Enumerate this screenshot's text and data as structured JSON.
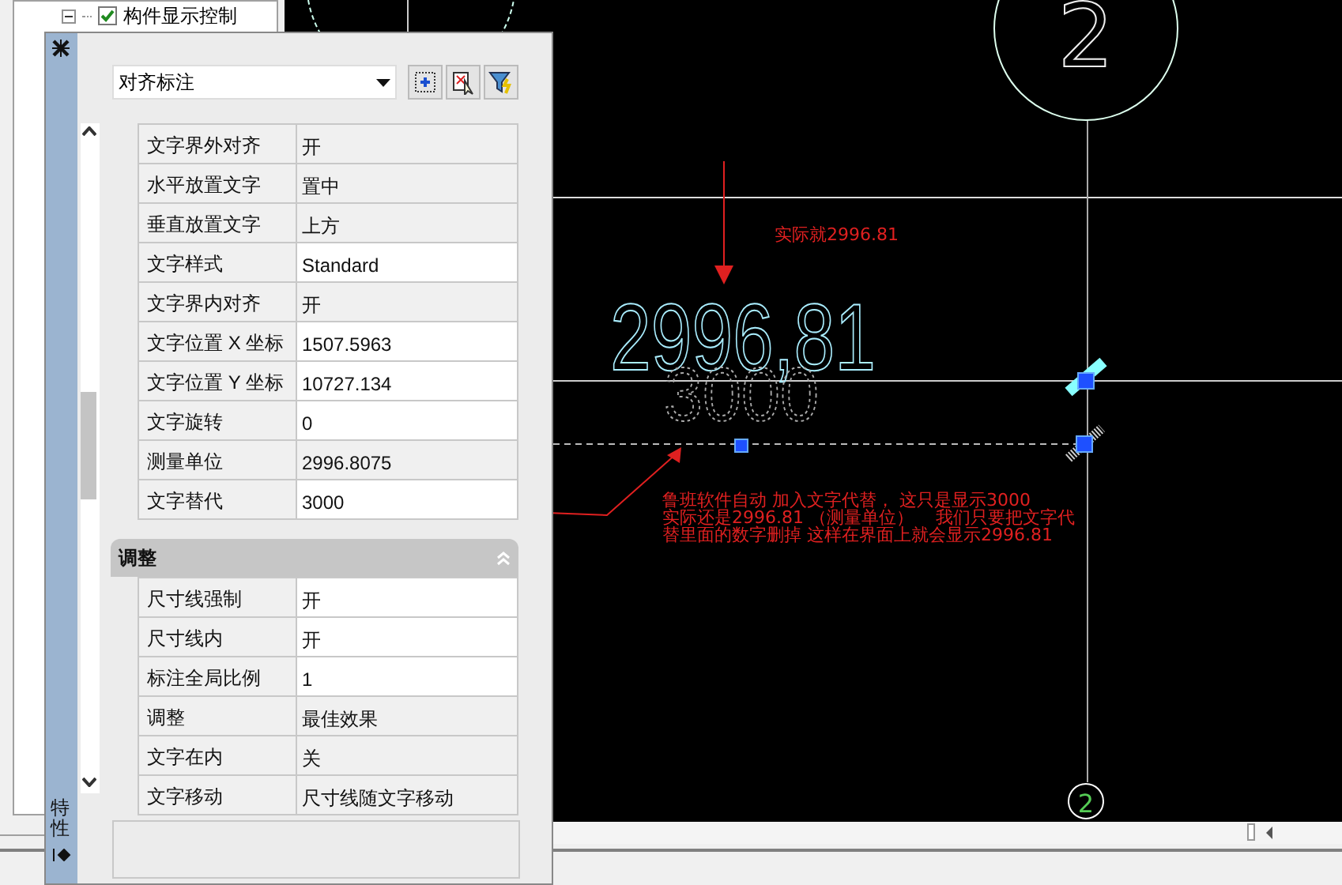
{
  "tree": {
    "items": [
      {
        "label": "构件显示控制",
        "checked": true,
        "expanded": true
      }
    ]
  },
  "palette": {
    "tab_label": "特性",
    "object_type": "对齐标注",
    "rows": [
      {
        "label": "文字界外对齐",
        "value": "开",
        "readonly": true
      },
      {
        "label": "水平放置文字",
        "value": "置中",
        "readonly": true
      },
      {
        "label": "垂直放置文字",
        "value": "上方",
        "readonly": true
      },
      {
        "label": "文字样式",
        "value": "Standard",
        "readonly": false
      },
      {
        "label": "文字界内对齐",
        "value": "开",
        "readonly": true
      },
      {
        "label": "文字位置 X 坐标",
        "value": "1507.5963",
        "readonly": false
      },
      {
        "label": "文字位置 Y 坐标",
        "value": "10727.134",
        "readonly": false
      },
      {
        "label": "文字旋转",
        "value": "0",
        "readonly": false
      },
      {
        "label": "测量单位",
        "value": "2996.8075",
        "readonly": true
      },
      {
        "label": "文字替代",
        "value": "3000",
        "readonly": false
      }
    ],
    "sections": [
      {
        "title": "调整",
        "expanded": true,
        "rows": [
          {
            "label": "尺寸线强制",
            "value": "开",
            "readonly": false
          },
          {
            "label": "尺寸线内",
            "value": "开",
            "readonly": false
          },
          {
            "label": "标注全局比例",
            "value": "1",
            "readonly": false
          },
          {
            "label": "调整",
            "value": "最佳效果",
            "readonly": true
          },
          {
            "label": "文字在内",
            "value": "关",
            "readonly": true
          },
          {
            "label": "文字移动",
            "value": "尺寸线随文字移动",
            "readonly": true
          }
        ]
      }
    ]
  },
  "drawing": {
    "dimension_text": "2996,81",
    "override_text": "3000",
    "top_note": "实际就2996.81",
    "note_lines": [
      "鲁班软件自动 加入文字代替， 这只是显示3000",
      "实际还是2996.81 （测量单位）    我们只要把文字代",
      "替里面的数字删掉 这样在界面上就会显示2996.81"
    ],
    "axis_bubbles": [
      "2",
      "2"
    ]
  }
}
